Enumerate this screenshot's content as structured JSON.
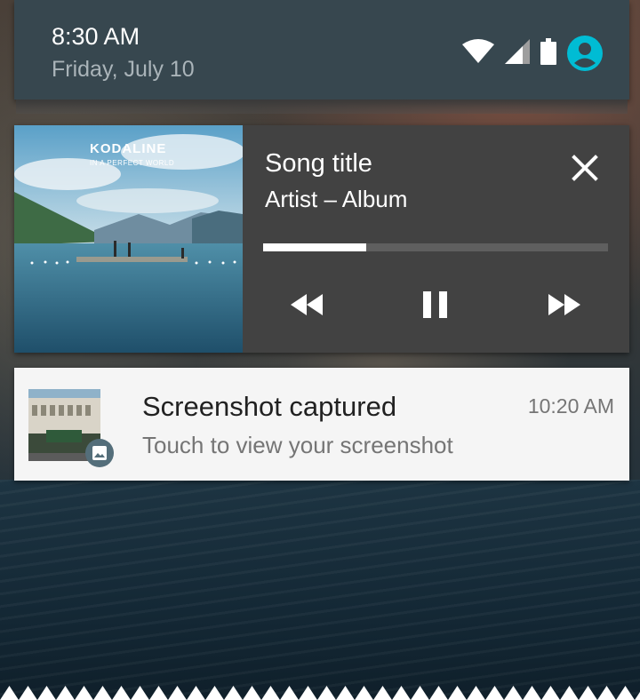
{
  "status_bar": {
    "time": "8:30 AM",
    "date": "Friday, July 10",
    "icons": [
      "wifi-icon",
      "signal-icon",
      "battery-icon",
      "account-icon"
    ],
    "accent_color": "#00bcd4"
  },
  "media_notification": {
    "album": {
      "band": "KODALINE",
      "album_name": "IN A PERFECT WORLD"
    },
    "song_title": "Song title",
    "artist_album": "Artist – Album",
    "progress": 0.3,
    "controls": [
      "rewind-icon",
      "pause-icon",
      "fast-forward-icon"
    ],
    "close_icon": "close-icon"
  },
  "screenshot_notification": {
    "title": "Screenshot captured",
    "text": "Touch to view your screenshot",
    "time": "10:20 AM",
    "badge_icon": "image-icon"
  },
  "colors": {
    "header_bg": "#37474f",
    "media_bg": "#424242",
    "notification_bg": "#f5f5f5"
  }
}
